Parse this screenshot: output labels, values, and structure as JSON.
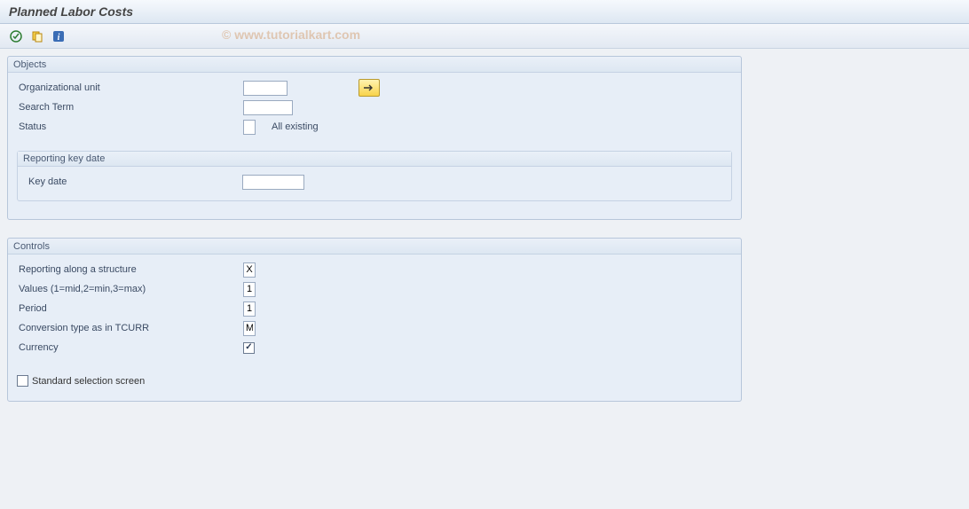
{
  "title": "Planned Labor Costs",
  "watermark": "© www.tutorialkart.com",
  "toolbar": {
    "execute": "Execute",
    "variant": "Get Variant",
    "info": "Information"
  },
  "objects": {
    "group_title": "Objects",
    "org_unit_label": "Organizational unit",
    "org_unit_value": "",
    "search_term_label": "Search Term",
    "search_term_value": "",
    "status_label": "Status",
    "status_value": "",
    "status_text": "All existing",
    "reporting_key_date": {
      "title": "Reporting key date",
      "key_date_label": "Key date",
      "key_date_value": ""
    }
  },
  "controls": {
    "group_title": "Controls",
    "reporting_structure_label": "Reporting along a structure",
    "reporting_structure_value": "X",
    "values_label": "Values (1=mid,2=min,3=max)",
    "values_value": "1",
    "period_label": "Period",
    "period_value": "1",
    "conversion_label": "Conversion type as in TCURR",
    "conversion_value": "M",
    "currency_label": "Currency",
    "currency_checked": true,
    "standard_selection_label": "Standard selection screen",
    "standard_selection_checked": false
  }
}
